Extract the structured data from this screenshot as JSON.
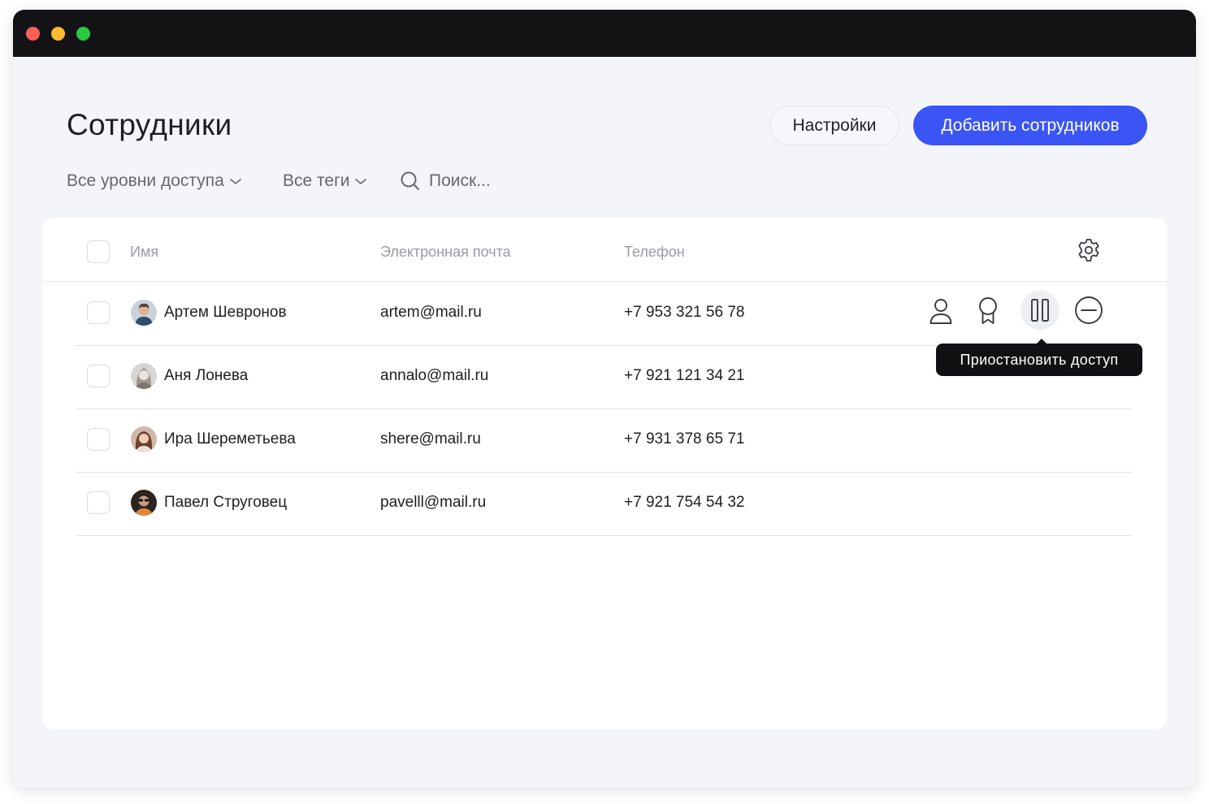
{
  "page": {
    "title": "Сотрудники"
  },
  "toolbar": {
    "settings_label": "Настройки",
    "add_label": "Добавить сотрудников"
  },
  "filters": {
    "access_label": "Все уровни доступа",
    "tags_label": "Все теги",
    "search_placeholder": "Поиск..."
  },
  "table": {
    "columns": {
      "name": "Имя",
      "email": "Электронная почта",
      "phone": "Телефон"
    },
    "rows": [
      {
        "name": "Артем Шевронов",
        "email": "artem@mail.ru",
        "phone": "+7 953 321 56 78",
        "avatar_color": "#8aa0b4"
      },
      {
        "name": "Аня Лонева",
        "email": "annalo@mail.ru",
        "phone": "+7 921 121 34 21",
        "avatar_color": "#b9b3ad"
      },
      {
        "name": "Ира Шереметьева",
        "email": "shere@mail.ru",
        "phone": "+7 931 378 65 71",
        "avatar_color": "#b88673"
      },
      {
        "name": "Павел Струговец",
        "email": "pavelll@mail.ru",
        "phone": "+7 921 754 54 32",
        "avatar_color": "#3a2a22"
      }
    ],
    "row_actions": [
      "user-icon",
      "award-icon",
      "pause-icon",
      "minus-circle-icon"
    ]
  },
  "tooltip": {
    "text": "Приостановить доступ"
  },
  "colors": {
    "accent": "#3b54f5",
    "titlebar": "#131316",
    "background": "#f4f5f9"
  }
}
